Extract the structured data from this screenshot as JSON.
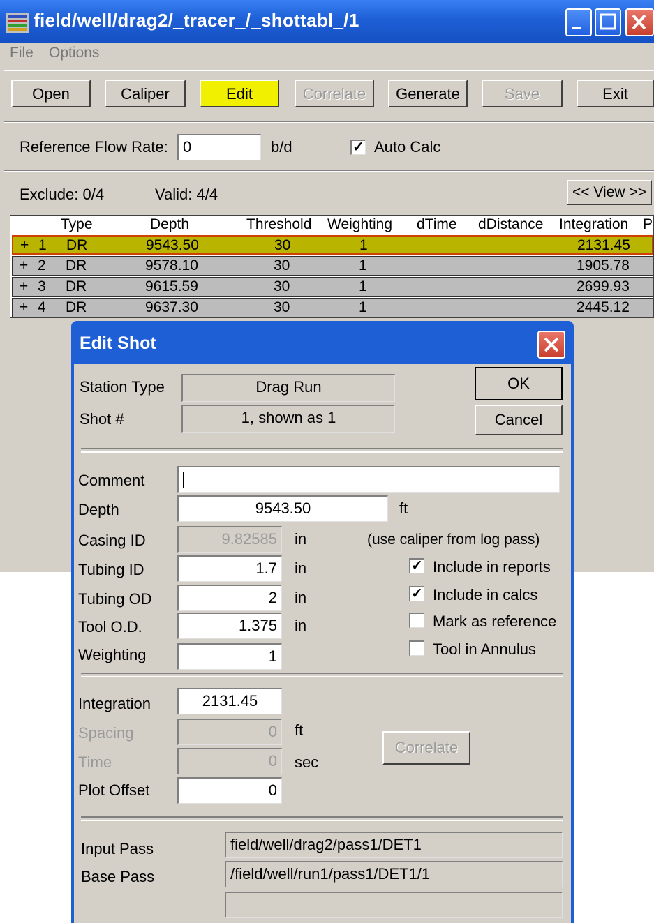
{
  "window": {
    "title": "field/well/drag2/_tracer_/_shottabl_/1",
    "menu": [
      "File",
      "Options"
    ]
  },
  "toolbar": {
    "buttons": [
      {
        "label": "Open",
        "enabled": true
      },
      {
        "label": "Caliper",
        "enabled": true
      },
      {
        "label": "Edit",
        "enabled": true,
        "active": true
      },
      {
        "label": "Correlate",
        "enabled": false
      },
      {
        "label": "Generate",
        "enabled": true
      },
      {
        "label": "Save",
        "enabled": false
      },
      {
        "label": "Exit",
        "enabled": true
      }
    ]
  },
  "reference": {
    "label": "Reference Flow Rate:",
    "value": "0",
    "unit": "b/d",
    "auto_calc_label": "Auto Calc",
    "auto_calc_checked": true
  },
  "status": {
    "exclude": "Exclude:  0/4",
    "valid": "Valid:  4/4",
    "view_button": "<< View >>"
  },
  "table": {
    "columns": [
      "Type",
      "Depth",
      "Threshold",
      "Weighting",
      "dTime",
      "dDistance",
      "Integration",
      "P"
    ],
    "rows": [
      {
        "expander": "+",
        "num": "1",
        "type": "DR",
        "depth": "9543.50",
        "threshold": "30",
        "weighting": "1",
        "integration": "2131.45",
        "selected": true
      },
      {
        "expander": "+",
        "num": "2",
        "type": "DR",
        "depth": "9578.10",
        "threshold": "30",
        "weighting": "1",
        "integration": "1905.78",
        "selected": false
      },
      {
        "expander": "+",
        "num": "3",
        "type": "DR",
        "depth": "9615.59",
        "threshold": "30",
        "weighting": "1",
        "integration": "2699.93",
        "selected": false
      },
      {
        "expander": "+",
        "num": "4",
        "type": "DR",
        "depth": "9637.30",
        "threshold": "30",
        "weighting": "1",
        "integration": "2445.12",
        "selected": false
      }
    ]
  },
  "dialog": {
    "title": "Edit Shot",
    "station_type_label": "Station Type",
    "station_type_value": "Drag Run",
    "shot_label": "Shot #",
    "shot_value": "1, shown as 1",
    "ok_label": "OK",
    "cancel_label": "Cancel",
    "comment_label": "Comment",
    "comment_value": "",
    "depth_label": "Depth",
    "depth_value": "9543.50",
    "depth_unit": "ft",
    "casing_label": "Casing ID",
    "casing_value": "9.82585",
    "casing_unit": "in",
    "caliper_note": "(use caliper from log pass)",
    "tubing_id_label": "Tubing ID",
    "tubing_id_value": "1.7",
    "tubing_id_unit": "in",
    "tubing_od_label": "Tubing OD",
    "tubing_od_value": "2",
    "tubing_od_unit": "in",
    "tool_od_label": "Tool O.D.",
    "tool_od_value": "1.375",
    "tool_od_unit": "in",
    "weighting_label": "Weighting",
    "weighting_value": "1",
    "checks": [
      {
        "label": "Include in reports",
        "checked": true
      },
      {
        "label": "Include in calcs",
        "checked": true
      },
      {
        "label": "Mark as reference",
        "checked": false
      },
      {
        "label": "Tool in Annulus",
        "checked": false
      }
    ],
    "integration_label": "Integration",
    "integration_value": "2131.45",
    "spacing_label": "Spacing",
    "spacing_value": "0",
    "spacing_unit": "ft",
    "time_label": "Time",
    "time_value": "0",
    "time_unit": "sec",
    "plot_offset_label": "Plot Offset",
    "plot_offset_value": "0",
    "correlate_label": "Correlate",
    "input_pass_label": "Input Pass",
    "input_pass_value": "field/well/drag2/pass1/DET1",
    "base_pass_label": "Base Pass",
    "base_pass_value": "/field/well/run1/pass1/DET1/1",
    "extra_pass_value": ""
  }
}
